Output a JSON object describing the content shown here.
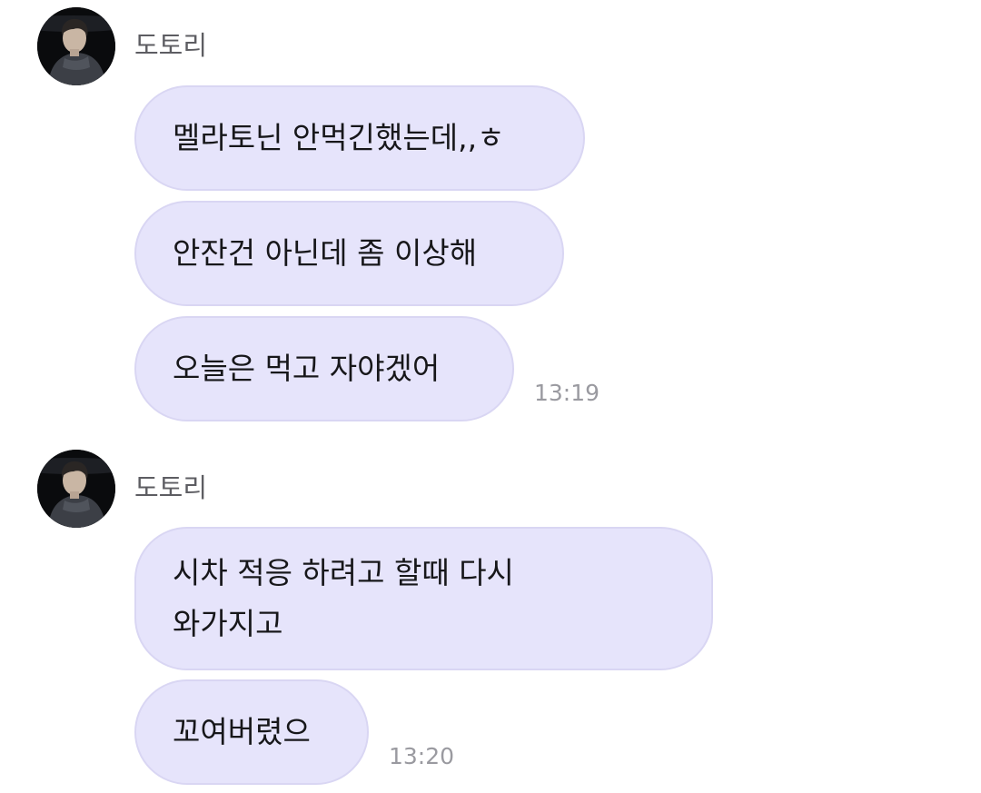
{
  "colors": {
    "bubble_bg": "#e6e4fb",
    "bubble_border": "#d9d6f3",
    "sender_text": "#5d5d62",
    "time_text": "#9a9aa0"
  },
  "groups": [
    {
      "sender": "도토리",
      "avatar_icon": "profile-photo",
      "messages": [
        "멜라토닌 안먹긴했는데,,ㅎ",
        "안잔건 아닌데  좀 이상해",
        "오늘은 먹고 자야겠어"
      ],
      "time": "13:19"
    },
    {
      "sender": "도토리",
      "avatar_icon": "profile-photo",
      "messages": [
        "시차 적응 하려고 할때 다시\n와가지고",
        "꼬여버렸으"
      ],
      "time": "13:20"
    }
  ]
}
